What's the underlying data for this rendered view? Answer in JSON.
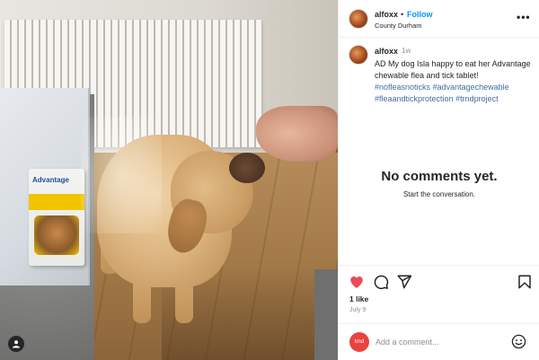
{
  "post": {
    "image_alt": "Labrador dog eating a treat from a hand next to a product box",
    "user_tag_icon": "person-icon"
  },
  "header": {
    "username": "alfoxx",
    "separator": "•",
    "follow_label": "Follow",
    "location": "County Durham",
    "more_icon": "more-horizontal-icon"
  },
  "caption": {
    "username": "alfoxx",
    "time": "1w",
    "text": "AD My dog Isla happy to eat her Advantage chewable flea and tick tablet!",
    "hashtags": [
      "#nofleasnoticks",
      "#advantagechewable",
      "#fleaandtickprotection",
      "#trndproject"
    ]
  },
  "comments": {
    "empty_title": "No comments yet.",
    "empty_subtitle": "Start the conversation."
  },
  "actions": {
    "like_icon": "heart-icon",
    "comment_icon": "comment-icon",
    "share_icon": "send-icon",
    "save_icon": "bookmark-icon",
    "likes": "1 like",
    "date": "July 9",
    "like_color": "#ed4956"
  },
  "add_comment": {
    "avatar_text": "trnd",
    "placeholder": "Add a comment...",
    "emoji_icon": "emoji-icon"
  },
  "product_box": {
    "brand": "Advantage"
  }
}
